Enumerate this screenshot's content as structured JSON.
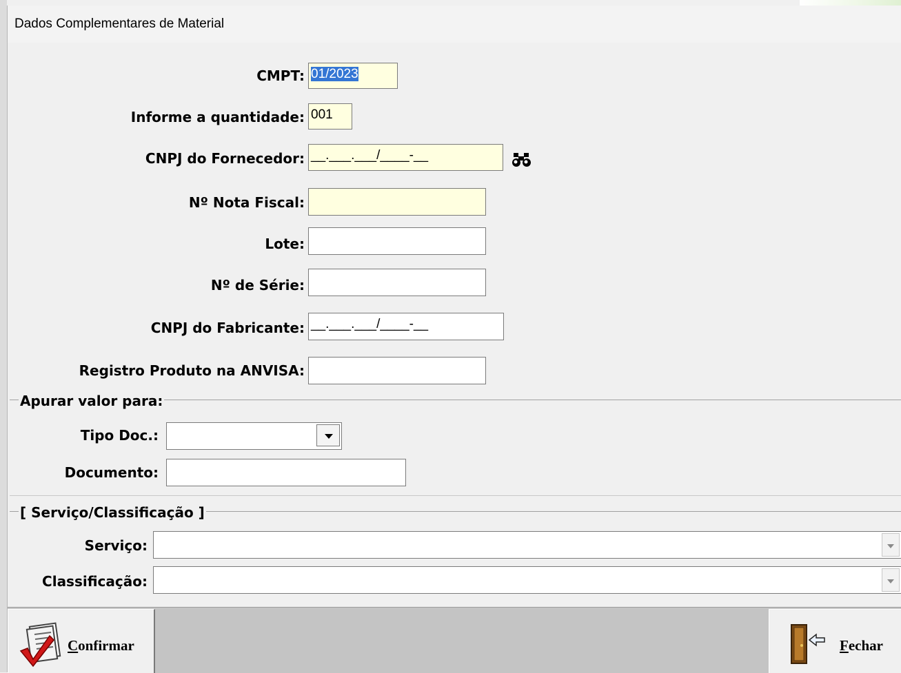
{
  "window": {
    "title": "Dados Complementares de Material"
  },
  "form": {
    "cmpt": {
      "label": "CMPT:",
      "value": "01/2023"
    },
    "quantidade": {
      "label": "Informe a quantidade:",
      "value": "001"
    },
    "cnpj_fornecedor": {
      "label": "CNPJ do Fornecedor:",
      "value": "__.___.___/____-__"
    },
    "nota_fiscal": {
      "label": "Nº Nota Fiscal:",
      "value": ""
    },
    "lote": {
      "label": "Lote:",
      "value": ""
    },
    "serie": {
      "label": "Nº de Série:",
      "value": ""
    },
    "cnpj_fabricante": {
      "label": "CNPJ do Fabricante:",
      "value": "__.___.___/____-__"
    },
    "registro_anvisa": {
      "label": "Registro Produto na ANVISA:",
      "value": ""
    }
  },
  "apurar": {
    "legend": "Apurar valor para:",
    "tipo_doc": {
      "label": "Tipo Doc.:",
      "value": ""
    },
    "documento": {
      "label": "Documento:",
      "value": ""
    }
  },
  "servico_group": {
    "legend": "[ Serviço/Classificação ]",
    "servico": {
      "label": "Serviço:",
      "value": ""
    },
    "classificacao": {
      "label": "Classificação:",
      "value": ""
    }
  },
  "toolbar": {
    "confirmar": {
      "accel": "C",
      "rest": "onfirmar"
    },
    "fechar": {
      "accel": "F",
      "rest": "echar"
    }
  },
  "icons": {
    "binoculars": "binoculars-icon",
    "confirm": "document-check-icon",
    "exit": "door-exit-icon"
  }
}
